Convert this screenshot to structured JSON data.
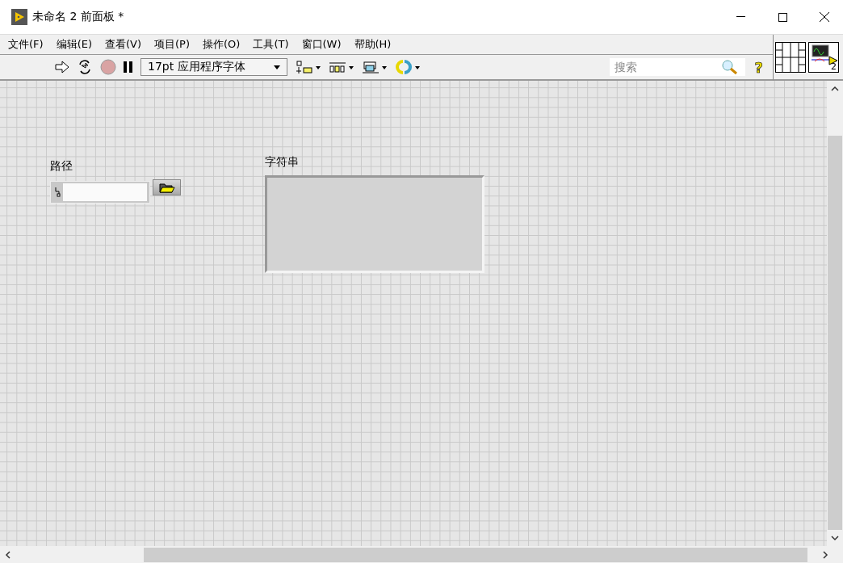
{
  "window": {
    "title": "未命名 2 前面板 *"
  },
  "menu": [
    "文件(F)",
    "编辑(E)",
    "查看(V)",
    "项目(P)",
    "操作(O)",
    "工具(T)",
    "窗口(W)",
    "帮助(H)"
  ],
  "toolbar": {
    "font": "17pt 应用程序字体",
    "search": {
      "placeholder": "搜索"
    },
    "vi_icon_number": "2",
    "help_glyph": "?"
  },
  "panel": {
    "controls": [
      {
        "kind": "path",
        "label": "路径"
      },
      {
        "kind": "string",
        "label": "字符串"
      }
    ]
  }
}
